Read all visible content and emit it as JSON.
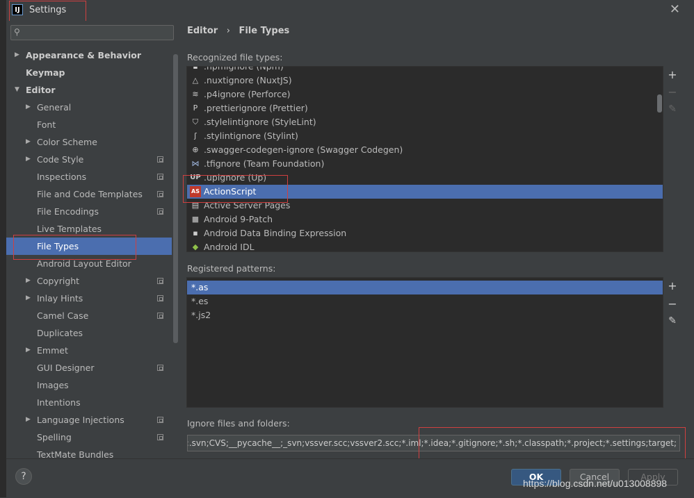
{
  "window": {
    "title": "Settings",
    "app_icon_letter": "IJ"
  },
  "search": {
    "placeholder": ""
  },
  "sidebar": {
    "items": [
      {
        "label": "Appearance & Behavior",
        "arrow": "▶",
        "bold": true
      },
      {
        "label": "Keymap",
        "bold": true
      },
      {
        "label": "Editor",
        "arrow": "▼",
        "bold": true
      },
      {
        "label": "General",
        "arrow": "▶"
      },
      {
        "label": "Font"
      },
      {
        "label": "Color Scheme",
        "arrow": "▶"
      },
      {
        "label": "Code Style",
        "arrow": "▶",
        "project": true
      },
      {
        "label": "Inspections",
        "project": true
      },
      {
        "label": "File and Code Templates",
        "project": true
      },
      {
        "label": "File Encodings",
        "project": true
      },
      {
        "label": "Live Templates"
      },
      {
        "label": "File Types",
        "selected": true
      },
      {
        "label": "Android Layout Editor"
      },
      {
        "label": "Copyright",
        "arrow": "▶",
        "project": true
      },
      {
        "label": "Inlay Hints",
        "arrow": "▶",
        "project": true
      },
      {
        "label": "Camel Case",
        "project": true
      },
      {
        "label": "Duplicates"
      },
      {
        "label": "Emmet",
        "arrow": "▶"
      },
      {
        "label": "GUI Designer",
        "project": true
      },
      {
        "label": "Images"
      },
      {
        "label": "Intentions"
      },
      {
        "label": "Language Injections",
        "arrow": "▶",
        "project": true
      },
      {
        "label": "Spelling",
        "project": true
      },
      {
        "label": "TextMate Bundles"
      }
    ]
  },
  "breadcrumb": {
    "parent": "Editor",
    "separator": "›",
    "current": "File Types"
  },
  "recognized": {
    "label": "Recognized file types:",
    "rows": [
      {
        "icon": "npm-icon",
        "glyph": "▪",
        "text": ".npmignore (Npm)"
      },
      {
        "icon": "nuxt-icon",
        "glyph": "△",
        "text": ".nuxtignore (NuxtJS)"
      },
      {
        "icon": "perforce-icon",
        "glyph": "≋",
        "text": ".p4ignore (Perforce)"
      },
      {
        "icon": "prettier-icon",
        "glyph": "P",
        "text": ".prettierignore (Prettier)"
      },
      {
        "icon": "stylelint-icon",
        "glyph": "⛉",
        "text": ".stylelintignore (StyleLint)"
      },
      {
        "icon": "stylint-icon",
        "glyph": "ʃ",
        "text": ".stylintignore (Stylint)"
      },
      {
        "icon": "swagger-icon",
        "glyph": "⊕",
        "text": ".swagger-codegen-ignore (Swagger Codegen)"
      },
      {
        "icon": "visual-studio-icon",
        "glyph": "⋈",
        "text": ".tfignore (Team Foundation)"
      },
      {
        "icon": "up-icon",
        "glyph": "UP",
        "text": ".upignore (Up)"
      },
      {
        "icon": "actionscript-icon",
        "glyph": "AS",
        "text": "ActionScript",
        "selected": true
      },
      {
        "icon": "asp-icon",
        "glyph": "▤",
        "text": "Active Server Pages"
      },
      {
        "icon": "folder-icon",
        "glyph": "■",
        "text": "Android 9-Patch"
      },
      {
        "icon": "data-binding-icon",
        "glyph": "▪",
        "text": "Android Data Binding Expression"
      },
      {
        "icon": "android-icon",
        "glyph": "◆",
        "text": "Android IDL"
      }
    ]
  },
  "patterns": {
    "label": "Registered patterns:",
    "rows": [
      {
        "text": "*.as",
        "selected": true
      },
      {
        "text": "*.es"
      },
      {
        "text": "*.js2"
      }
    ]
  },
  "tools": {
    "add": "+",
    "remove": "−",
    "edit": "✎"
  },
  "ignore": {
    "label": "Ignore files and folders:",
    "value": "*.hprof;*.pyc;*.pyo;*.rbc;*.yarb;*~;.DS_Store;.git;.hg;.svn;CVS;__pycache__;_svn;vssver.scc;vssver2.scc;*.iml;*.idea;*.gitignore;*.sh;*.classpath;*.project;*.settings;target;"
  },
  "footer": {
    "help": "?",
    "ok": "OK",
    "cancel": "Cancel",
    "apply": "Apply"
  },
  "watermark": "https://blog.csdn.net/u013008898",
  "colors": {
    "selection": "#4b6eaf",
    "highlight_box": "#d04040",
    "background": "#3c3f41",
    "list_background": "#2b2b2b"
  }
}
